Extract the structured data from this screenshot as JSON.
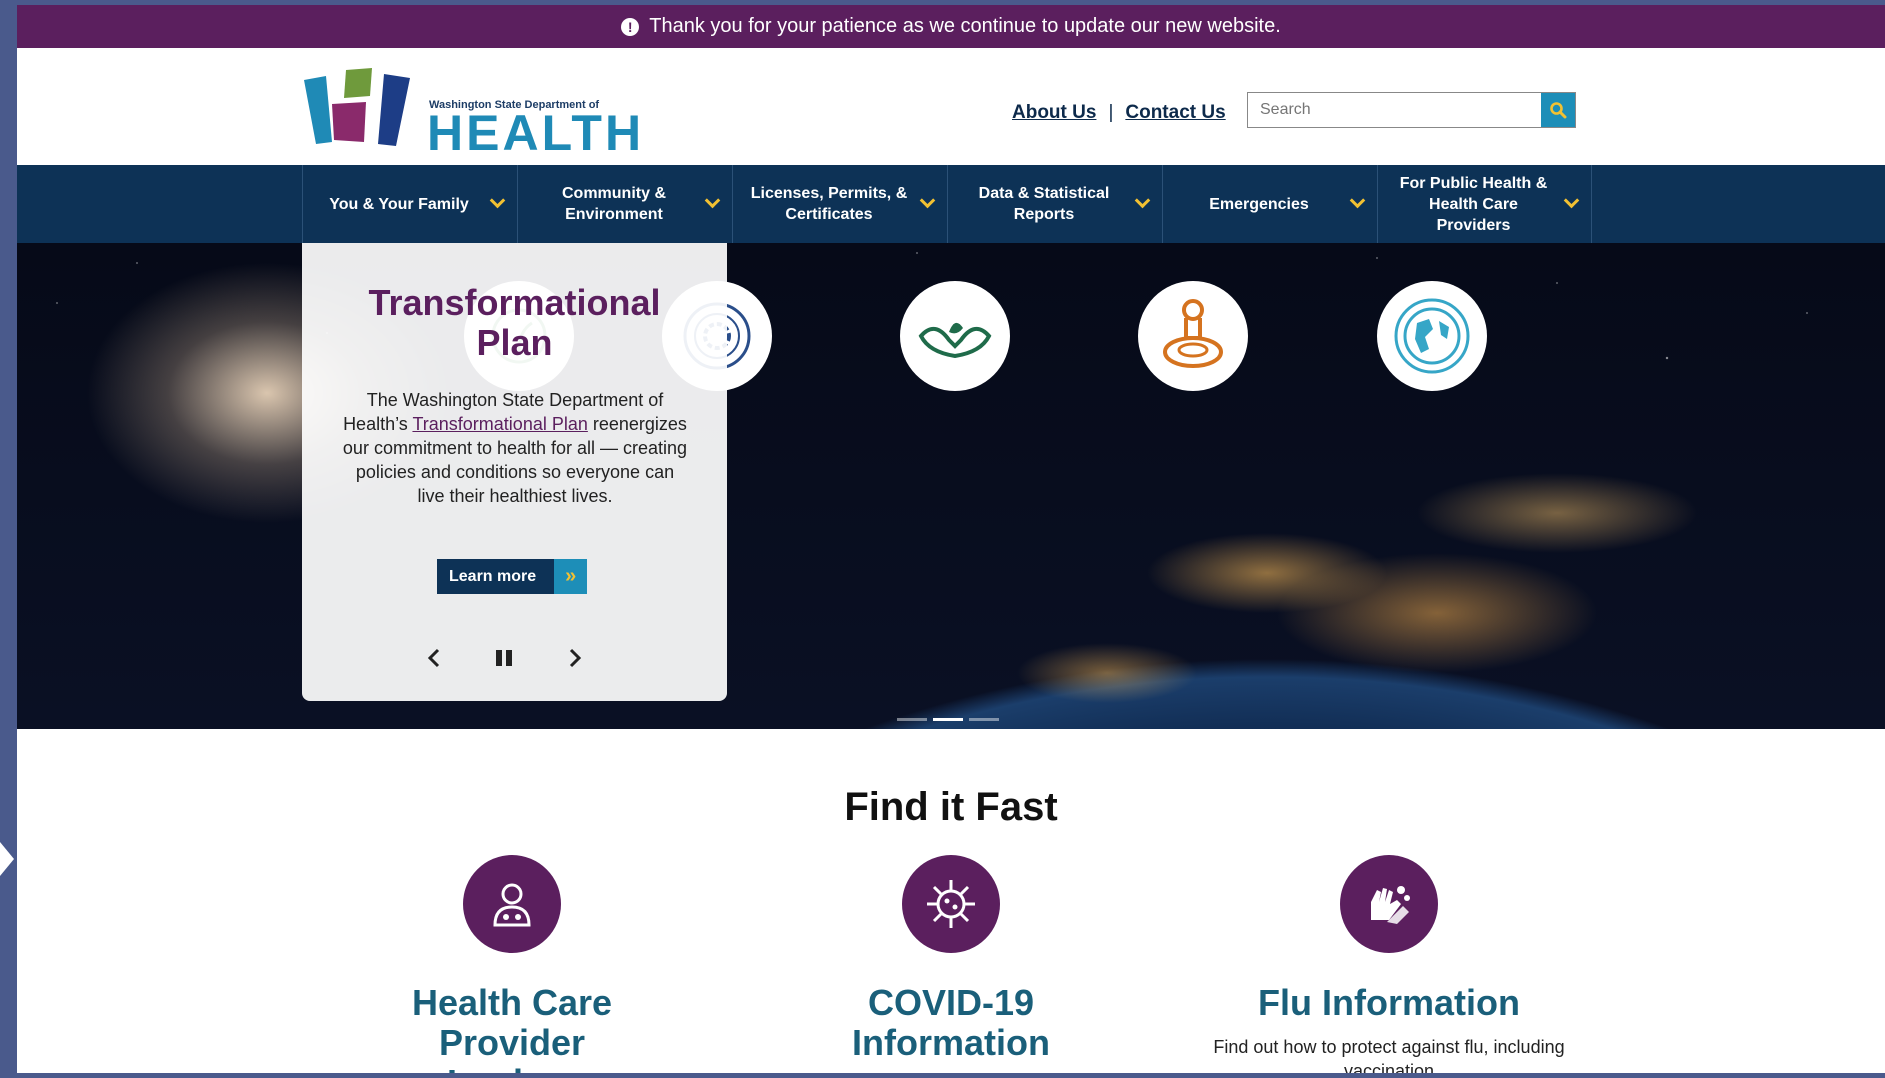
{
  "alert": {
    "text": "Thank you for your patience as we continue to update our new website."
  },
  "header": {
    "logo_small": "Washington State Department of",
    "logo_big": "HEALTH",
    "about": "About Us",
    "contact": "Contact Us",
    "search_placeholder": "Search"
  },
  "nav": {
    "items": [
      {
        "label": "You & Your Family"
      },
      {
        "label": "Community & Environment"
      },
      {
        "label": "Licenses, Permits, & Certificates"
      },
      {
        "label": "Data & Statistical Reports"
      },
      {
        "label": "Emergencies"
      },
      {
        "label": "For Public Health & Health Care Providers"
      }
    ]
  },
  "hero": {
    "title": "Transformational Plan",
    "text_before": "The Washington State Department of Health’s ",
    "link_text": "Transformational Plan",
    "text_after": " reenergizes our commitment to health for all — creating policies and conditions so everyone can live their healthiest lives.",
    "button_label": "Learn more",
    "slides_total": 3,
    "active_slide": 2
  },
  "find_it_fast": {
    "title": "Find it Fast",
    "items": [
      {
        "title": "Health Care Provider Lookup",
        "desc": "",
        "icon": "provider-icon"
      },
      {
        "title": "COVID-19 Information",
        "desc": "",
        "icon": "virus-icon"
      },
      {
        "title": "Flu Information",
        "desc": "Find out how to protect against flu, including vaccination",
        "icon": "handwash-icon"
      }
    ]
  },
  "colors": {
    "purple": "#5b1f5e",
    "navy": "#0d3256",
    "teal": "#1d8eb8",
    "gold": "#f2c132",
    "heading_teal": "#1a5f7a"
  }
}
